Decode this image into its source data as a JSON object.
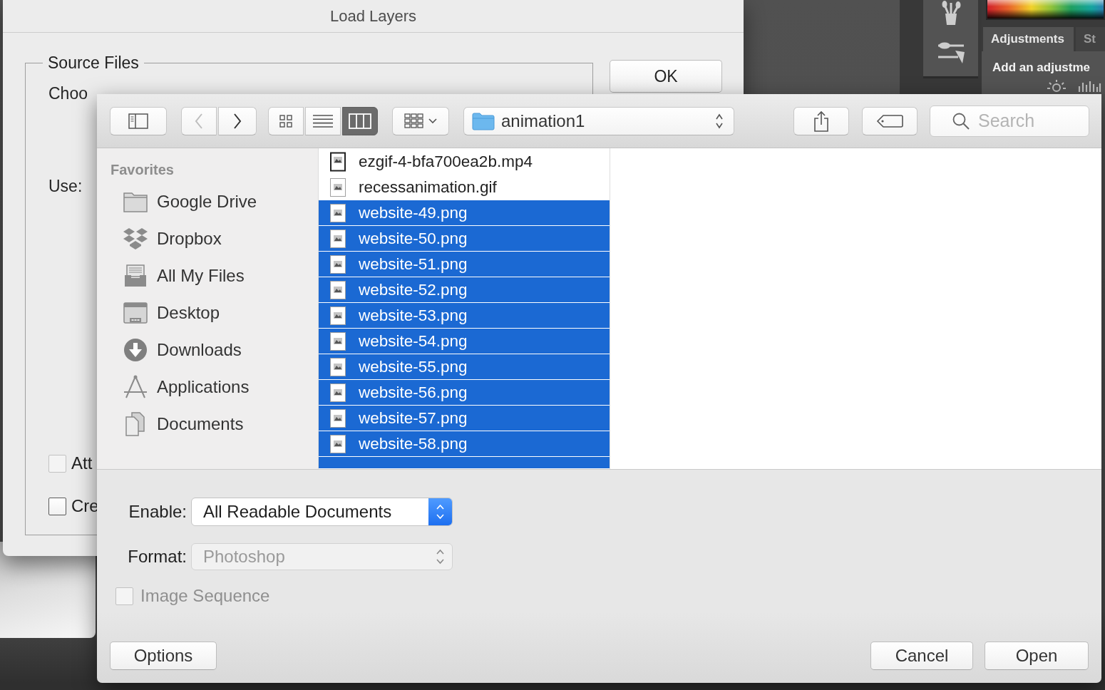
{
  "load_layers_dialog": {
    "title": "Load Layers",
    "group_label": "Source Files",
    "instructions": "Choo",
    "use_label": "Use:",
    "checkboxes": [
      {
        "label": "Att",
        "checked": false,
        "disabled": true
      },
      {
        "label": "Cre",
        "checked": false,
        "disabled": false
      }
    ],
    "ok_button": "OK"
  },
  "adjustments_panel": {
    "tabs": [
      {
        "label": "Adjustments",
        "selected": true
      },
      {
        "label": "St",
        "selected": false
      }
    ],
    "hint": "Add an adjustme"
  },
  "open_sheet": {
    "toolbar": {
      "nav_buttons": [
        {
          "kind": "back",
          "disabled": true
        },
        {
          "kind": "forward",
          "disabled": false
        }
      ],
      "view_modes": [
        {
          "kind": "icons",
          "selected": false
        },
        {
          "kind": "list",
          "selected": false
        },
        {
          "kind": "columns",
          "selected": true
        }
      ],
      "location": "animation1",
      "search": {
        "placeholder": "Search"
      }
    },
    "sidebar": {
      "sections": [
        {
          "title": "Favorites",
          "items": [
            {
              "label": "Google Drive",
              "kind": "folder",
              "selected": false
            },
            {
              "label": "Dropbox",
              "kind": "dropbox",
              "selected": false
            },
            {
              "label": "All My Files",
              "kind": "all_files",
              "selected": false
            },
            {
              "label": "Desktop",
              "kind": "desktop",
              "selected": false
            },
            {
              "label": "Downloads",
              "kind": "downloads",
              "selected": false
            },
            {
              "label": "Applications",
              "kind": "applications",
              "selected": false
            },
            {
              "label": "Documents",
              "kind": "documents",
              "selected": false
            }
          ]
        }
      ]
    },
    "files": [
      {
        "name": "ezgif-4-bfa700ea2b.mp4",
        "kind": "video",
        "selected": false
      },
      {
        "name": "recessanimation.gif",
        "kind": "image",
        "selected": false
      },
      {
        "name": "website-49.png",
        "kind": "image",
        "selected": true
      },
      {
        "name": "website-50.png",
        "kind": "image",
        "selected": true
      },
      {
        "name": "website-51.png",
        "kind": "image",
        "selected": true
      },
      {
        "name": "website-52.png",
        "kind": "image",
        "selected": true
      },
      {
        "name": "website-53.png",
        "kind": "image",
        "selected": true
      },
      {
        "name": "website-54.png",
        "kind": "image",
        "selected": true
      },
      {
        "name": "website-55.png",
        "kind": "image",
        "selected": true
      },
      {
        "name": "website-56.png",
        "kind": "image",
        "selected": true
      },
      {
        "name": "website-57.png",
        "kind": "image",
        "selected": true
      },
      {
        "name": "website-58.png",
        "kind": "image",
        "selected": true
      },
      {
        "kind": "partial",
        "selected": true
      }
    ],
    "enable": {
      "label": "Enable:",
      "value": "All Readable Documents",
      "disabled": false
    },
    "format": {
      "label": "Format:",
      "value": "Photoshop",
      "disabled": true
    },
    "image_sequence": {
      "label": "Image Sequence",
      "checked": false,
      "disabled": true
    },
    "buttons": [
      {
        "label": "Options",
        "kind": "options"
      },
      {
        "label": "Cancel",
        "kind": "cancel"
      },
      {
        "label": "Open",
        "kind": "open"
      }
    ]
  }
}
